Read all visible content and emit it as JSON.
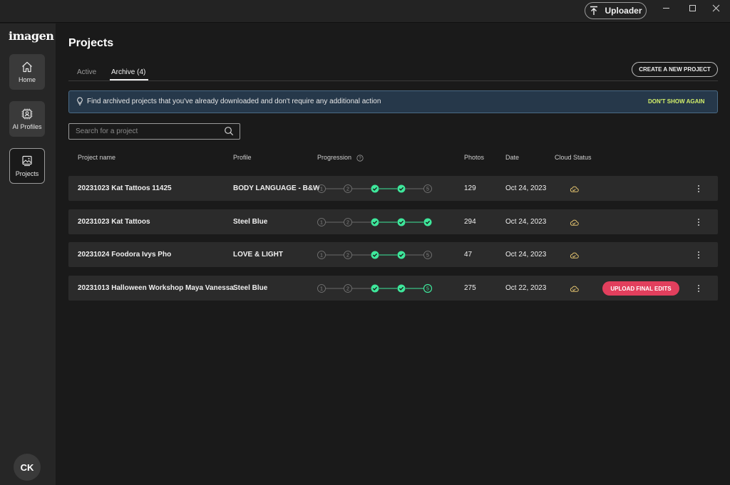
{
  "window": {
    "uploader_label": "Uploader",
    "uploader_icon": "upload-arrow-icon",
    "controls": [
      "minimize-icon",
      "maximize-icon",
      "close-icon"
    ]
  },
  "sidebar": {
    "logo": "imagen",
    "items": [
      {
        "label": "Home",
        "icon": "home-icon",
        "active": false
      },
      {
        "label": "AI Profiles",
        "icon": "ai-profile-icon",
        "active": false
      },
      {
        "label": "Projects",
        "icon": "projects-icon",
        "active": true
      }
    ],
    "avatar": "CK"
  },
  "page": {
    "title": "Projects",
    "tabs": [
      {
        "label": "Active",
        "active": false
      },
      {
        "label": "Archive (4)",
        "active": true
      }
    ],
    "create_button": "CREATE A NEW PROJECT"
  },
  "banner": {
    "icon": "lightbulb-icon",
    "message": "Find archived projects that you've already downloaded and don't require any additional action",
    "dismiss": "DON'T SHOW AGAIN"
  },
  "search": {
    "placeholder": "Search for a project",
    "value": ""
  },
  "table": {
    "columns": [
      "Project name",
      "Profile",
      "Progression",
      "Photos",
      "Date",
      "Cloud Status"
    ],
    "rows": [
      {
        "name": "20231023 Kat Tattoos 11425",
        "profile": "BODY LANGUAGE - B&W",
        "steps": [
          "1",
          "2",
          "done",
          "done",
          "5"
        ],
        "current_step": null,
        "photos": "129",
        "date": "Oct 24, 2023",
        "action": ""
      },
      {
        "name": "20231023 Kat Tattoos",
        "profile": "Steel Blue",
        "steps": [
          "1",
          "2",
          "done",
          "done",
          "done"
        ],
        "current_step": null,
        "photos": "294",
        "date": "Oct 24, 2023",
        "action": ""
      },
      {
        "name": "20231024 Foodora Ivys Pho",
        "profile": "LOVE & LIGHT",
        "steps": [
          "1",
          "2",
          "done",
          "done",
          "5"
        ],
        "current_step": null,
        "photos": "47",
        "date": "Oct 24, 2023",
        "action": ""
      },
      {
        "name": "20231013 Halloween Workshop Maya Vanessa",
        "profile": "Steel Blue",
        "steps": [
          "1",
          "2",
          "done",
          "done",
          "5"
        ],
        "current_step": 5,
        "photos": "275",
        "date": "Oct 22, 2023",
        "action": "UPLOAD FINAL EDITS"
      }
    ]
  },
  "colors": {
    "accent_green": "#3ee79b",
    "action_red": "#e23f5d",
    "banner_link": "#d4f06a",
    "cloud_icon": "#e2c26e"
  }
}
